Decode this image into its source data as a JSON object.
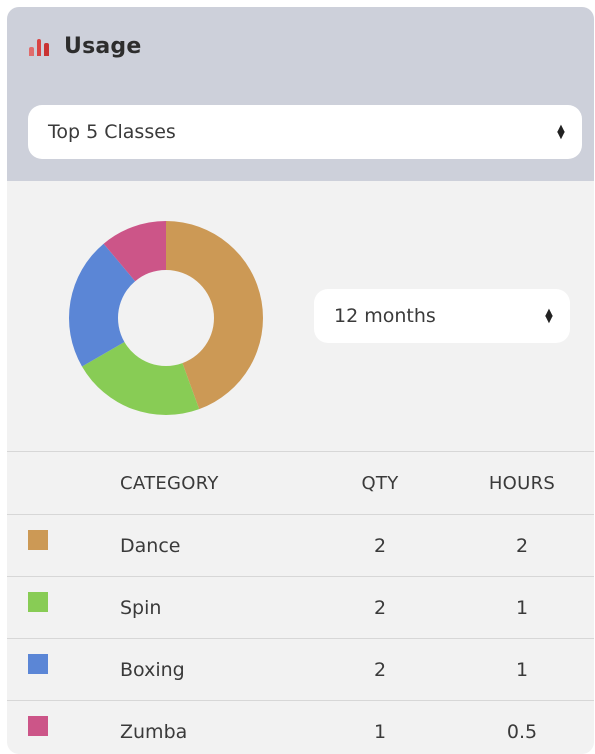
{
  "widget": {
    "title": "Usage",
    "title_icon": "bar-chart-icon",
    "icon_colors": [
      "#e06c6c",
      "#d94444",
      "#c93333"
    ]
  },
  "classes_select": {
    "value": "Top 5 Classes"
  },
  "period_select": {
    "value": "12 months"
  },
  "table": {
    "headers": {
      "category": "CATEGORY",
      "qty": "QTY",
      "hours": "HOURS"
    },
    "rows": [
      {
        "category": "Dance",
        "qty": "2",
        "hours": "2",
        "color": "#cc9955"
      },
      {
        "category": "Spin",
        "qty": "2",
        "hours": "1",
        "color": "#88cc55"
      },
      {
        "category": "Boxing",
        "qty": "2",
        "hours": "1",
        "color": "#5b86d6"
      },
      {
        "category": "Zumba",
        "qty": "1",
        "hours": "0.5",
        "color": "#cc5588"
      }
    ]
  },
  "chart_data": {
    "type": "pie",
    "categories": [
      "Dance",
      "Spin",
      "Boxing",
      "Zumba"
    ],
    "values": [
      2,
      1,
      1,
      0.5
    ],
    "colors": [
      "#cc9955",
      "#88cc55",
      "#5b86d6",
      "#cc5588"
    ],
    "style": "donut"
  }
}
